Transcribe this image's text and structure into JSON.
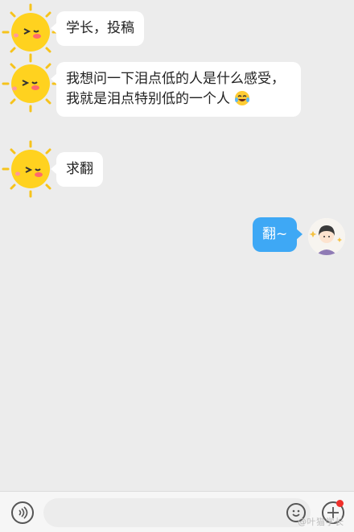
{
  "messages": [
    {
      "sender": "other",
      "text": "学长，投稿"
    },
    {
      "sender": "other",
      "text": "我想问一下泪点低的人是什么感受，我就是泪点特别低的一个人"
    },
    {
      "sender": "other",
      "text": "求翻"
    },
    {
      "sender": "me",
      "text": "翻~"
    }
  ],
  "icons": {
    "sender_avatar": "sun-face-icon",
    "my_avatar": "cartoon-person-icon",
    "inline_emoji": "crying-laughing-emoji-icon",
    "voice": "voice-icon",
    "emoji": "emoji-face-icon",
    "plus": "plus-icon"
  },
  "colors": {
    "my_bubble": "#3ea8f5",
    "other_bubble": "#ffffff",
    "background": "#ececec",
    "notification_dot": "#f0302b"
  },
  "watermark": "@叶猫学长"
}
